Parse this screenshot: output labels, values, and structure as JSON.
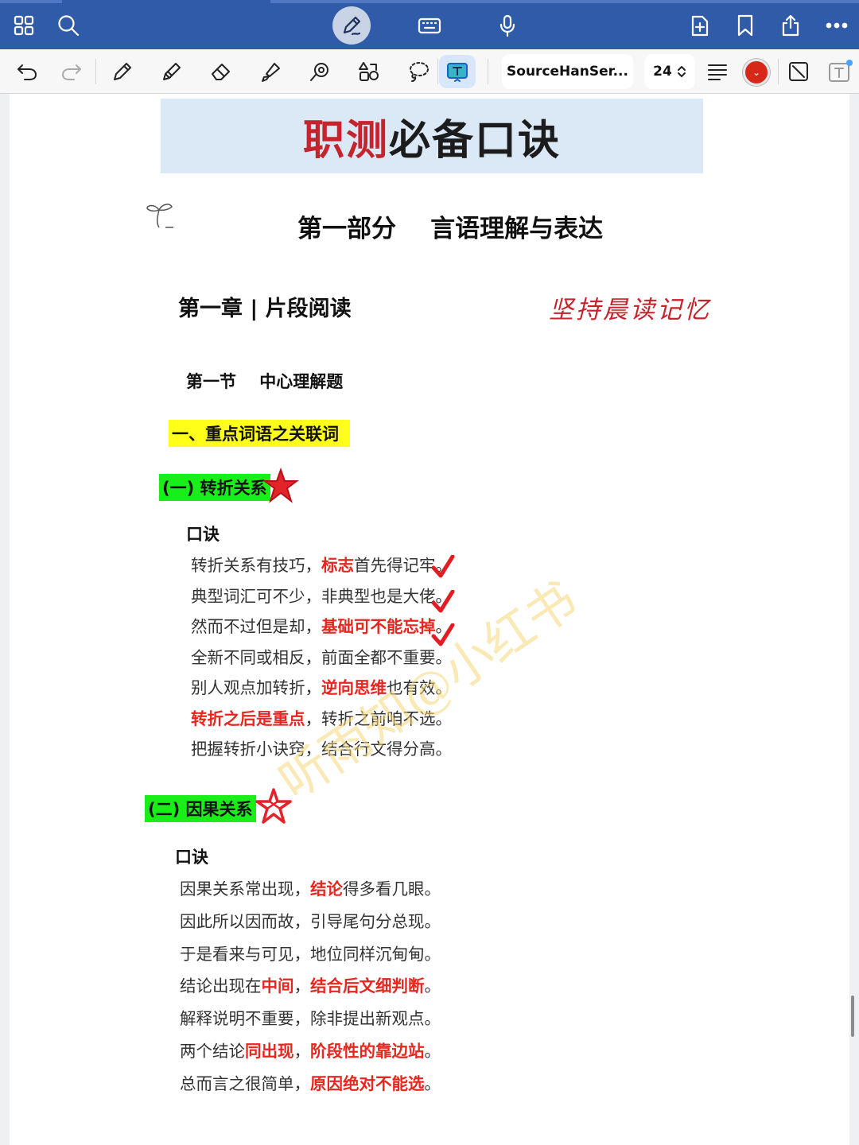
{
  "toolbar": {
    "font_name": "SourceHanSer...",
    "font_size": "24",
    "active_color": "#d62718"
  },
  "document": {
    "title_part1": "职测",
    "title_part2": "必备口诀",
    "part_title": "第一部分    言语理解与表达",
    "chapter_title": "第一章 | 片段阅读",
    "handwritten_note": "坚持晨读记忆",
    "section_title": "第一节    中心理解题",
    "subsection_title": "一、重点词语之关联词",
    "watermark": "听雨知@小红书",
    "blocks": [
      {
        "heading": "(一) 转折关系",
        "koujue": "口诀",
        "lines": [
          [
            {
              "t": "转折关系有技巧，"
            },
            {
              "t": "标志",
              "red": true
            },
            {
              "t": "首先得记牢。"
            }
          ],
          [
            {
              "t": "典型词汇可不少，非典型也是大佬。"
            }
          ],
          [
            {
              "t": "然而不过但是却，"
            },
            {
              "t": "基础可不能忘掉",
              "red": true
            },
            {
              "t": "。"
            }
          ],
          [
            {
              "t": "全新不同或相反，前面全都不重要。"
            }
          ],
          [
            {
              "t": "别人观点加转折，"
            },
            {
              "t": "逆向思维",
              "red": true
            },
            {
              "t": "也有效。"
            }
          ],
          [
            {
              "t": "转折之后是重点",
              "red": true
            },
            {
              "t": "，转折之前咱不选。"
            }
          ],
          [
            {
              "t": "把握转折小诀窍，结合行文得分高。"
            }
          ]
        ]
      },
      {
        "heading": "(二) 因果关系",
        "koujue": "口诀",
        "lines": [
          [
            {
              "t": "因果关系常出现，"
            },
            {
              "t": "结论",
              "red": true
            },
            {
              "t": "得多看几眼。"
            }
          ],
          [
            {
              "t": "因此所以因而故，引导尾句分总现。"
            }
          ],
          [
            {
              "t": "于是看来与可见，地位同样沉甸甸。"
            }
          ],
          [
            {
              "t": "结论出现在"
            },
            {
              "t": "中间",
              "red": true
            },
            {
              "t": "，"
            },
            {
              "t": "结合后文细判断",
              "red": true
            },
            {
              "t": "。"
            }
          ],
          [
            {
              "t": "解释说明不重要，除非提出新观点。"
            }
          ],
          [
            {
              "t": "两个结论"
            },
            {
              "t": "同出现",
              "red": true
            },
            {
              "t": "，"
            },
            {
              "t": "阶段性的靠边站",
              "red": true
            },
            {
              "t": "。"
            }
          ],
          [
            {
              "t": "总而言之很简单，"
            },
            {
              "t": "原因绝对不能选",
              "red": true
            },
            {
              "t": "。"
            }
          ]
        ]
      }
    ]
  }
}
